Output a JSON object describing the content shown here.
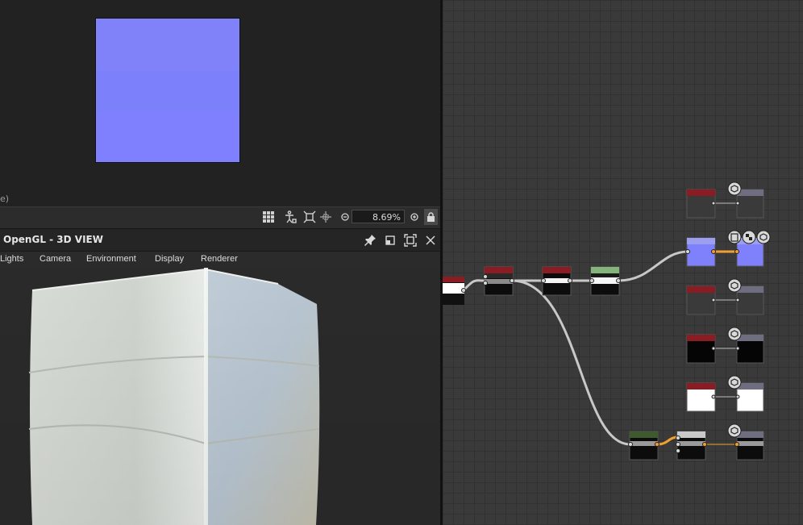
{
  "preview2d": {
    "partial_text": "e)",
    "zoom_value": "8.69%"
  },
  "toolbar2d": {
    "icons": [
      "grid-icon",
      "person-tiling-icon",
      "fit-frame-icon",
      "move-view-icon",
      "zoom-out-icon",
      "zoom-in-icon",
      "lock-icon"
    ]
  },
  "view3d": {
    "title": "OpenGL - 3D VIEW",
    "header_icons": [
      "pin-icon",
      "float-icon",
      "maximize-icon",
      "close-icon"
    ],
    "menu": [
      "Lights",
      "Camera",
      "Environment",
      "Display",
      "Renderer"
    ]
  },
  "colors": {
    "normal_map": "#7e81fb",
    "graph_bg": "#3a3a3a",
    "wire": "#c8c8c8",
    "active_wire": "#f0a030",
    "node_red": "#8a1d23",
    "node_green_light": "#86b27c",
    "node_green_dark": "#3e5a2e",
    "node_output_gray": "#6e6e80"
  }
}
